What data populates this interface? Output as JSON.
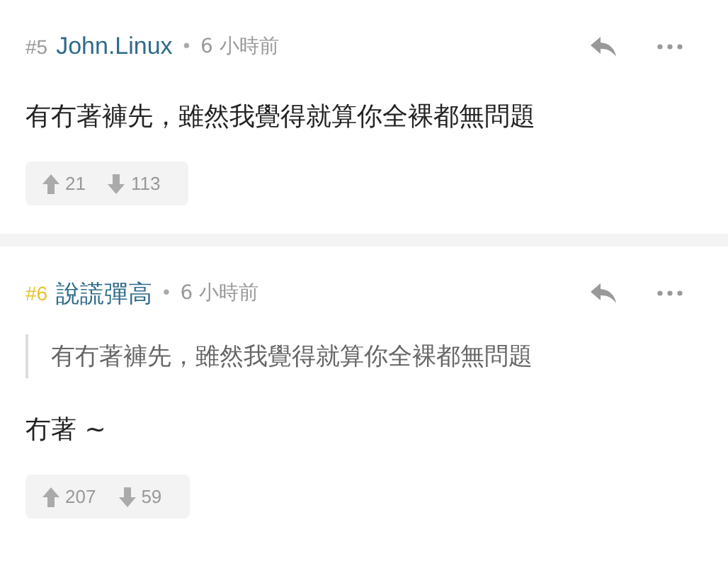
{
  "comments": [
    {
      "floor": "#5",
      "color": "#999999",
      "author": "John.Linux",
      "separator": "•",
      "time": "6 小時前",
      "body": "有冇著褲先，雖然我覺得就算你全裸都無問題",
      "upvotes": "21",
      "downvotes": "113"
    },
    {
      "floor": "#6",
      "color": "#e6c12e",
      "author": "說謊彈高",
      "separator": "•",
      "time": "6 小時前",
      "quote": "有冇著褲先，雖然我覺得就算你全裸都無問題",
      "body": "冇著 ~",
      "upvotes": "207",
      "downvotes": "59"
    }
  ]
}
